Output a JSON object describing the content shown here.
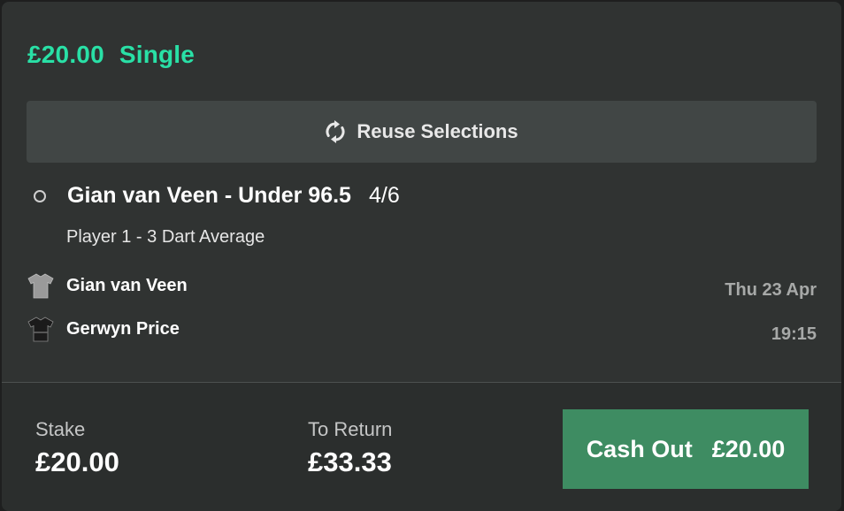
{
  "bet": {
    "stake_display": "£20.00",
    "type": "Single"
  },
  "reuse_button": {
    "label": "Reuse Selections",
    "icon": "refresh-icon"
  },
  "selection": {
    "name": "Gian van Veen - Under 96.5",
    "odds": "4/6",
    "market": "Player 1 - 3 Dart Average"
  },
  "event": {
    "team1": {
      "name": "Gian van Veen",
      "icon": "shirt-icon",
      "shirt_color": "#9a9a9a"
    },
    "team2": {
      "name": "Gerwyn Price",
      "icon": "shirt-icon",
      "shirt_color": "#1b1b1b"
    },
    "date": "Thu 23 Apr",
    "time": "19:15"
  },
  "footer": {
    "stake_label": "Stake",
    "stake_value": "£20.00",
    "return_label": "To Return",
    "return_value": "£33.33",
    "cashout_label": "Cash Out",
    "cashout_value": "£20.00"
  },
  "colors": {
    "accent": "#29e0a6",
    "cashout_button": "#3e8c62",
    "card_background": "#303332"
  }
}
